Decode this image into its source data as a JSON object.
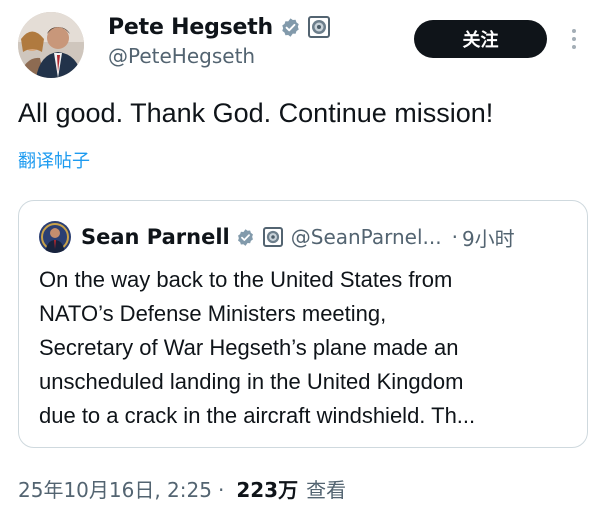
{
  "author": {
    "display_name": "Pete Hegseth",
    "handle": "@PeteHegseth",
    "verified_color": "#829aab",
    "icons": [
      "verified-badge-icon",
      "affiliation-badge-icon"
    ]
  },
  "follow_button": {
    "label": "关注"
  },
  "more_menu": {
    "icon": "more-vertical-icon"
  },
  "post": {
    "text": "All good. Thank God. Continue mission!",
    "translate_label": "翻译帖子"
  },
  "quote": {
    "display_name": "Sean Parnell",
    "handle": "@SeanParnel...",
    "separator": "·",
    "time": "9小时",
    "lines": [
      "On the way back to the United States from",
      "NATO’s Defense Ministers meeting,",
      "Secretary of War Hegseth’s plane made an",
      "unscheduled landing in the United Kingdom",
      "due to a crack in the aircraft windshield. Th..."
    ]
  },
  "meta": {
    "date_time": "25年10月16日, 2:25",
    "separator": "·",
    "views_count": "223万",
    "views_label": "查看"
  },
  "colors": {
    "text_primary": "#0f1419",
    "text_secondary": "#536471",
    "link": "#1d9bf0",
    "border": "#cfd9de",
    "button_bg": "#0f1419"
  }
}
